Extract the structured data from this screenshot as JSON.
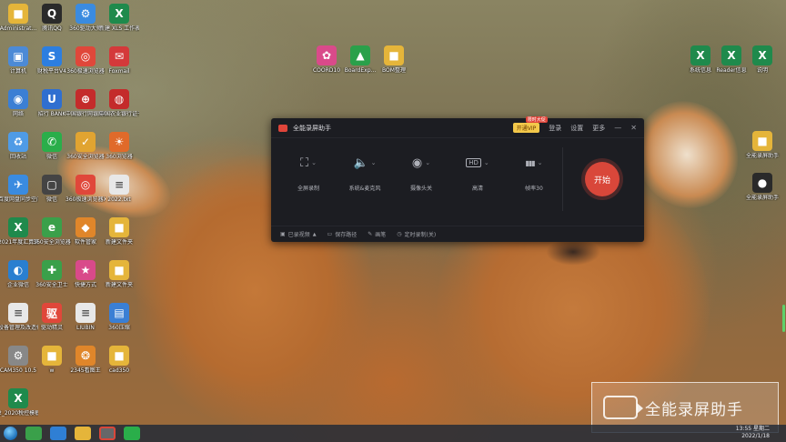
{
  "desktop_icons": [
    {
      "label": "Administrat...",
      "color": "#e5b53a",
      "glyph": "■",
      "icon": "folder-user-icon"
    },
    {
      "label": "腾讯QQ",
      "color": "#2a2a2a",
      "glyph": "Q",
      "icon": "qq-icon"
    },
    {
      "label": "360驱动大师",
      "color": "#3a8be0",
      "glyph": "⚙",
      "icon": "driver-icon"
    },
    {
      "label": "新建 XLS 工作表.xls",
      "color": "#1f8a4c",
      "glyph": "X",
      "icon": "excel-icon"
    },
    {
      "label": "计算机",
      "color": "#4c8ad6",
      "glyph": "▣",
      "icon": "computer-icon"
    },
    {
      "label": "财税平台V4",
      "color": "#2c7ee0",
      "glyph": "S",
      "icon": "tax-icon"
    },
    {
      "label": "360极速浏览器",
      "color": "#e0473a",
      "glyph": "◎",
      "icon": "browser-360-icon"
    },
    {
      "label": "Foxmail",
      "color": "#d4393a",
      "glyph": "✉",
      "icon": "foxmail-icon"
    },
    {
      "label": "网络",
      "color": "#3b7fd4",
      "glyph": "◉",
      "icon": "network-icon"
    },
    {
      "label": "招行 BANK",
      "color": "#2f6fd0",
      "glyph": "U",
      "icon": "bank-icon"
    },
    {
      "label": "中国银行网银助手",
      "color": "#c42b2b",
      "glyph": "⊕",
      "icon": "boc-icon"
    },
    {
      "label": "中国农业银行证书",
      "color": "#c42b2b",
      "glyph": "◍",
      "icon": "abc-icon"
    },
    {
      "label": "回收站",
      "color": "#4f9be6",
      "glyph": "♻",
      "icon": "recycle-bin-icon"
    },
    {
      "label": "微信",
      "color": "#2aae4a",
      "glyph": "✆",
      "icon": "wechat-icon"
    },
    {
      "label": "360安全浏览器",
      "color": "#e1a431",
      "glyph": "✓",
      "icon": "safe-browser-icon"
    },
    {
      "label": "360浏览器",
      "color": "#e06a2a",
      "glyph": "☀",
      "icon": "browser-icon"
    },
    {
      "label": "百度网盘同步空间",
      "color": "#3a8be0",
      "glyph": "✈",
      "icon": "baidu-sync-icon"
    },
    {
      "label": "微信",
      "color": "#444",
      "glyph": "▢",
      "icon": "app-icon"
    },
    {
      "label": "360极速浏览器X",
      "color": "#e0473a",
      "glyph": "◎",
      "icon": "browser-x-icon"
    },
    {
      "label": "2022.txt",
      "color": "#e8e8e8",
      "glyph": "≡",
      "icon": "text-file-icon"
    },
    {
      "label": "2021年度汇算清缴改考核清单",
      "color": "#1f8a4c",
      "glyph": "X",
      "icon": "excel-icon"
    },
    {
      "label": "360安全浏览器",
      "color": "#3aa04a",
      "glyph": "e",
      "icon": "ie-icon"
    },
    {
      "label": "软件管家",
      "color": "#e0862a",
      "glyph": "◆",
      "icon": "software-manager-icon"
    },
    {
      "label": "新建文件夹",
      "color": "#e5b53a",
      "glyph": "■",
      "icon": "folder-icon"
    },
    {
      "label": "企业微信",
      "color": "#2a7fd0",
      "glyph": "◐",
      "icon": "wecom-icon"
    },
    {
      "label": "360安全卫士",
      "color": "#3aa04a",
      "glyph": "✚",
      "icon": "security-icon"
    },
    {
      "label": "快捷方式",
      "color": "#d94a8a",
      "glyph": "★",
      "icon": "shortcut-icon"
    },
    {
      "label": "新建文件夹",
      "color": "#e5b53a",
      "glyph": "■",
      "icon": "folder-icon"
    },
    {
      "label": "设备管理及改造修改",
      "color": "#e8e8e8",
      "glyph": "≡",
      "icon": "doc-icon"
    },
    {
      "label": "驱动精灵",
      "color": "#e0473a",
      "glyph": "驱",
      "icon": "driver-genius-icon"
    },
    {
      "label": "LIUBIN",
      "color": "#e8e8e8",
      "glyph": "≡",
      "icon": "doc-icon"
    },
    {
      "label": "360压缩",
      "color": "#3a7fd4",
      "glyph": "▤",
      "icon": "zip-icon"
    },
    {
      "label": "CAM350 10.5",
      "color": "#888",
      "glyph": "⚙",
      "icon": "cam350-icon"
    },
    {
      "label": "w",
      "color": "#e5b53a",
      "glyph": "■",
      "icon": "folder-icon"
    },
    {
      "label": "2345看图王",
      "color": "#e0862a",
      "glyph": "❂",
      "icon": "image-viewer-icon"
    },
    {
      "label": "cad350",
      "color": "#e5b53a",
      "glyph": "■",
      "icon": "folder-icon"
    },
    {
      "label": "2_2020税控模板(完善",
      "color": "#1f8a4c",
      "glyph": "X",
      "icon": "excel-icon"
    }
  ],
  "mid_icons": [
    {
      "label": "COORD10",
      "color": "#d94a8a",
      "glyph": "✿",
      "icon": "coord-icon"
    },
    {
      "label": "BoardExp...",
      "color": "#2aa04a",
      "glyph": "▲",
      "icon": "board-icon"
    },
    {
      "label": "BOM整理",
      "color": "#e5b53a",
      "glyph": "■",
      "icon": "folder-icon"
    }
  ],
  "right_icons": [
    {
      "label": "系统信息",
      "color": "#1f8a4c",
      "glyph": "X",
      "icon": "excel-icon"
    },
    {
      "label": "Reader信息",
      "color": "#1f8a4c",
      "glyph": "X",
      "icon": "excel-icon"
    },
    {
      "label": "说明",
      "color": "#1f8a4c",
      "glyph": "X",
      "icon": "excel-icon"
    },
    {
      "label": "全能录屏助手",
      "color": "#e5b53a",
      "glyph": "■",
      "icon": "folder-icon"
    },
    {
      "label": "全能录屏助手",
      "color": "#2a2a2a",
      "glyph": "●",
      "icon": "recorder-icon"
    }
  ],
  "app": {
    "title": "全能录屏助手",
    "vip_label": "开通VIP",
    "vip_tag": "限时大促",
    "login": "登录",
    "settings": "设置",
    "more": "更多",
    "minimize": "—",
    "close": "✕",
    "tools": [
      {
        "label": "全屏录制",
        "icon": "fullscreen-icon",
        "glyph": "⛶"
      },
      {
        "label": "系统&麦克风",
        "icon": "speaker-icon",
        "glyph": "🔈"
      },
      {
        "label": "摄像头关",
        "icon": "webcam-icon",
        "glyph": "◉"
      },
      {
        "label": "高清",
        "icon": "hd-icon",
        "glyph": "HD"
      },
      {
        "label": "帧率30",
        "icon": "framerate-icon",
        "glyph": "▮▮▮"
      }
    ],
    "start": "开始",
    "bottom": [
      {
        "label": "已录视频",
        "icon": "video-list-icon",
        "glyph": "▣",
        "chev": "▲"
      },
      {
        "label": "保存路径",
        "icon": "folder-path-icon",
        "glyph": "▭"
      },
      {
        "label": "画笔",
        "icon": "pen-icon",
        "glyph": "✎"
      },
      {
        "label": "定时录制(关)",
        "icon": "timer-icon",
        "glyph": "◷"
      }
    ]
  },
  "watermark": {
    "text": "全能录屏助手"
  },
  "taskbar": {
    "time": "13:55 星期二",
    "date": "2022/1/18"
  }
}
